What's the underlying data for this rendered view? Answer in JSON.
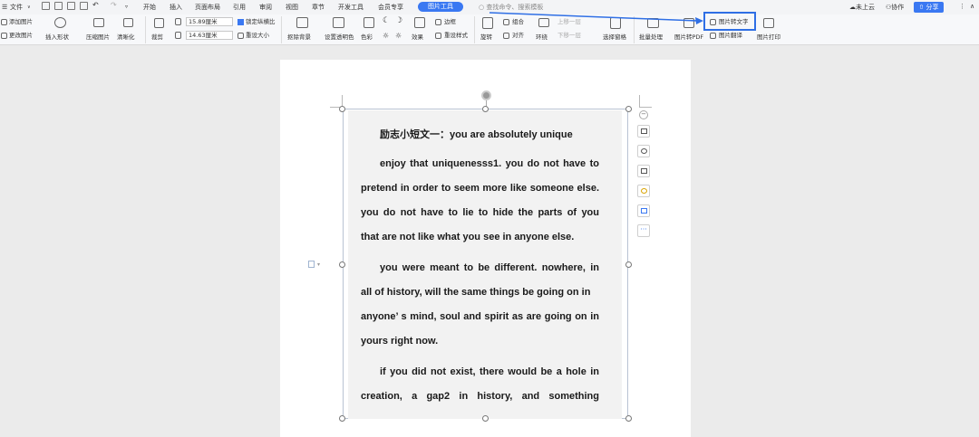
{
  "menubar": {
    "file": "文件",
    "file_caret": "∨",
    "tabs": [
      "开始",
      "插入",
      "页面布局",
      "引用",
      "审阅",
      "视图",
      "章节",
      "开发工具",
      "会员专享"
    ],
    "active_tab": "图片工具",
    "search_placeholder": "查找命令、搜索模板",
    "cloud": "未上云",
    "collab": "协作",
    "share": "分享"
  },
  "ribbon": {
    "add_picture": "添加图片",
    "change_picture": "更改图片",
    "insert_shape": "插入形状",
    "compress": "压缩图片",
    "clarity": "清晰化",
    "crop": "裁剪",
    "width_value": "15.89厘米",
    "height_value": "14.63厘米",
    "lock_ratio": "锁定纵横比",
    "reset_size": "重设大小",
    "remove_bg": "抠除背景",
    "set_transparent": "设置透明色",
    "color": "色彩",
    "effects": "效果",
    "border": "边框",
    "reset_style": "重设样式",
    "rotate": "旋转",
    "group": "组合",
    "align": "对齐",
    "wrap": "环绕",
    "up_one": "上移一层",
    "down_one": "下移一层",
    "select_pane": "选择窗格",
    "batch": "批量处理",
    "to_pdf": "图片转PDF",
    "to_text": "图片转文字",
    "translate": "图片翻译",
    "print": "图片打印"
  },
  "document": {
    "title_line": "励志小短文一：you are absolutely unique",
    "lines": [
      "enjoy that uniquenesss1. you do not have to",
      "pretend in order to seem more like someone else.",
      "you do not have to lie to hide the parts of you",
      "that are not like what you see in anyone else.",
      "you were meant to be different. nowhere, in",
      "all of history, will the same things be going on in",
      "anyone’ s mind, soul and spirit as are going on in",
      "yours right now.",
      "if you did not exist, there would be a hole in",
      "creation,  a  gap2  in  history,  and  something"
    ]
  },
  "colors": {
    "accent": "#3a78f2",
    "highlight_box": "#2f6fe5",
    "arrow": "#2f6fe5"
  }
}
